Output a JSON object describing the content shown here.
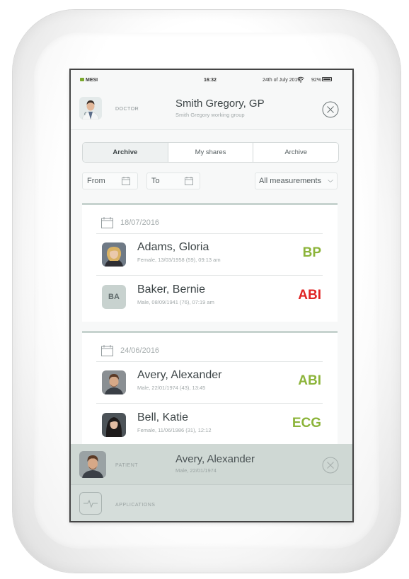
{
  "status_bar": {
    "carrier": "MESI",
    "time": "16:32",
    "date": "24th of July 2016",
    "battery": "92%"
  },
  "doctor": {
    "role": "DOCTOR",
    "name": "Smith Gregory, GP",
    "group": "Smith Gregory working group"
  },
  "tabs": [
    {
      "label": "Archive",
      "active": true
    },
    {
      "label": "My shares",
      "active": false
    },
    {
      "label": "Archive",
      "active": false
    }
  ],
  "filters": {
    "from_label": "From",
    "to_label": "To",
    "measurements_selected": "All measurements"
  },
  "archive_groups": [
    {
      "date": "18/07/2016",
      "entries": [
        {
          "name": "Adams, Gloria",
          "meta": "Female, 13/03/1958 (59), 09:13 am",
          "type": "BP",
          "type_color": "#8cb43a",
          "avatar": "photo"
        },
        {
          "name": "Baker, Bernie",
          "meta": "Male, 08/09/1941 (76), 07:19 am",
          "type": "ABI",
          "type_color": "#e02424",
          "avatar": "initials",
          "initials": "BA"
        }
      ]
    },
    {
      "date": "24/06/2016",
      "entries": [
        {
          "name": "Avery, Alexander",
          "meta": "Male, 22/01/1974 (43), 13:45",
          "type": "ABI",
          "type_color": "#8cb43a",
          "avatar": "photo"
        },
        {
          "name": "Bell, Katie",
          "meta": "Female, 11/06/1986 (31), 12:12",
          "type": "ECG",
          "type_color": "#8cb43a",
          "avatar": "photo"
        }
      ]
    }
  ],
  "patient": {
    "role": "PATIENT",
    "name": "Avery, Alexander",
    "meta": "Male, 22/01/1974"
  },
  "applications": {
    "label": "APPLICATIONS"
  }
}
